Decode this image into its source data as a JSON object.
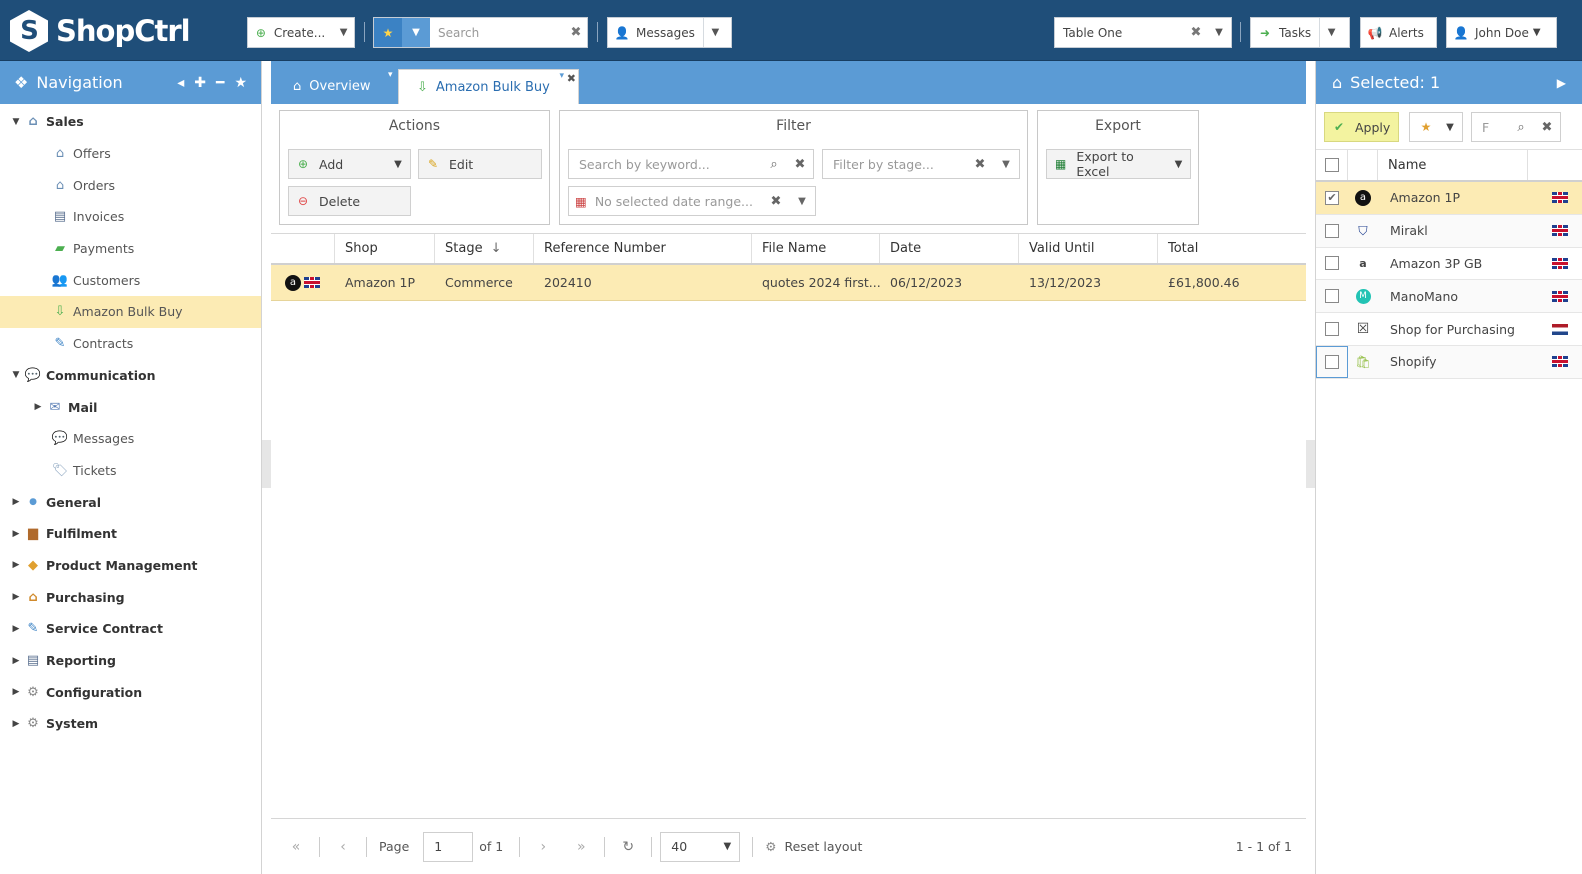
{
  "app": {
    "logo_text": "ShopCtrl"
  },
  "topbar": {
    "create_label": "Create...",
    "search_placeholder": "Search",
    "messages_label": "Messages",
    "table_value": "Table One",
    "tasks_label": "Tasks",
    "alerts_label": "Alerts",
    "user_label": "John Doe"
  },
  "nav": {
    "title": "Navigation",
    "items": [
      {
        "label": "Sales"
      },
      {
        "label": "Offers"
      },
      {
        "label": "Orders"
      },
      {
        "label": "Invoices"
      },
      {
        "label": "Payments"
      },
      {
        "label": "Customers"
      },
      {
        "label": "Amazon Bulk Buy"
      },
      {
        "label": "Contracts"
      },
      {
        "label": "Communication"
      },
      {
        "label": "Mail"
      },
      {
        "label": "Messages"
      },
      {
        "label": "Tickets"
      },
      {
        "label": "General"
      },
      {
        "label": "Fulfilment"
      },
      {
        "label": "Product Management"
      },
      {
        "label": "Purchasing"
      },
      {
        "label": "Service Contract"
      },
      {
        "label": "Reporting"
      },
      {
        "label": "Configuration"
      },
      {
        "label": "System"
      }
    ]
  },
  "tabs": [
    {
      "label": "Overview"
    },
    {
      "label": "Amazon Bulk Buy"
    }
  ],
  "actions": {
    "title": "Actions",
    "add": "Add",
    "edit": "Edit",
    "delete": "Delete"
  },
  "filter": {
    "title": "Filter",
    "keyword_placeholder": "Search by keyword...",
    "stage_placeholder": "Filter by stage...",
    "date_placeholder": "No selected date range..."
  },
  "export": {
    "title": "Export",
    "excel": "Export to Excel"
  },
  "grid": {
    "columns": [
      "Shop",
      "Stage",
      "Reference Number",
      "File Name",
      "Date",
      "Valid Until",
      "Total"
    ],
    "rows": [
      {
        "shop": "Amazon 1P",
        "stage": "Commerce",
        "ref": "202410",
        "file": "quotes 2024 first...",
        "date": "06/12/2023",
        "valid": "13/12/2023",
        "total": "£61,800.46"
      }
    ]
  },
  "pager": {
    "page_label": "Page",
    "page_value": "1",
    "of_label": "of 1",
    "page_size": "40",
    "reset_label": "Reset layout",
    "summary": "1 - 1 of 1"
  },
  "right": {
    "title": "Selected: 1",
    "apply": "Apply",
    "search_value": "F",
    "name_header": "Name",
    "shops": [
      {
        "name": "Amazon 1P",
        "flag": "gb",
        "checked": true
      },
      {
        "name": "Mirakl",
        "flag": "gb",
        "checked": false
      },
      {
        "name": "Amazon 3P GB",
        "flag": "gb",
        "checked": false
      },
      {
        "name": "ManoMano",
        "flag": "gb",
        "checked": false
      },
      {
        "name": "Shop for Purchasing",
        "flag": "nl",
        "checked": false
      },
      {
        "name": "Shopify",
        "flag": "gb",
        "checked": false
      }
    ]
  }
}
